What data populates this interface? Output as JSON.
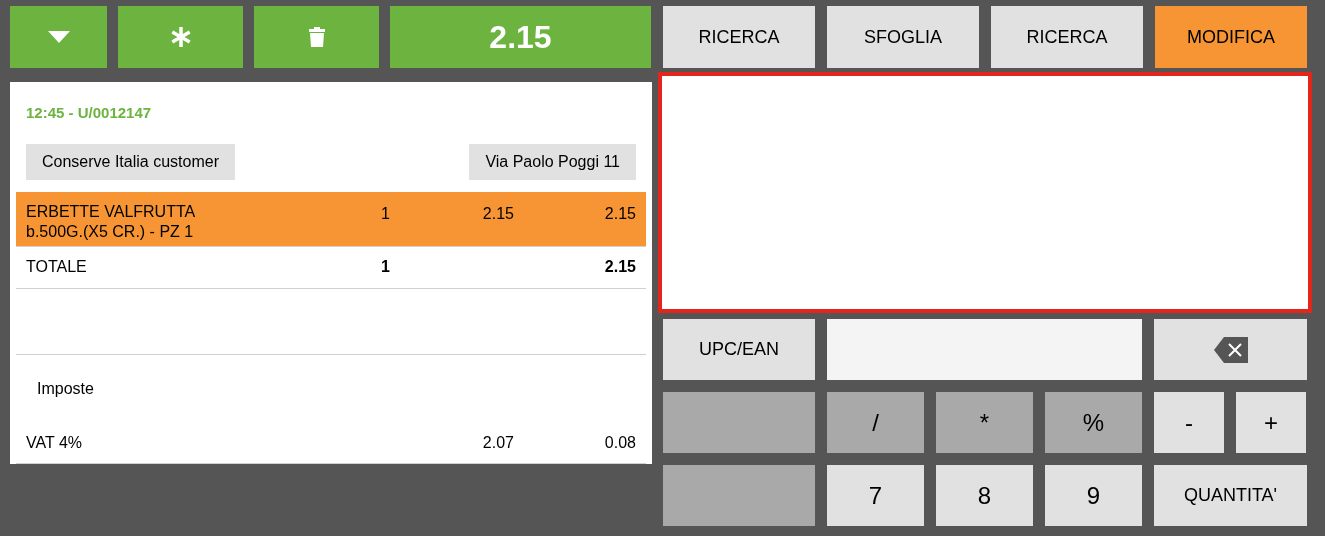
{
  "toolbar": {
    "buttons": [
      {
        "kind": "caret"
      },
      {
        "kind": "asterisk"
      },
      {
        "kind": "trash"
      }
    ],
    "total": "2.15"
  },
  "receipt": {
    "header": "12:45 - U/0012147",
    "customer": "Conserve Italia customer",
    "address": "Via Paolo Poggi 11",
    "items": [
      {
        "description": [
          "ERBETTE VALFRUTTA",
          "b.500G.(X5 CR.) - PZ 1"
        ],
        "quantity": "1",
        "price": "2.15",
        "amount": "2.15",
        "selected": true
      }
    ],
    "totals": {
      "label": "TOTALE",
      "quantity": "1",
      "amount": "2.15"
    },
    "taxes": {
      "title": "Imposte",
      "rows": [
        {
          "label": "VAT 4%",
          "base": "2.07",
          "tax": "0.08"
        }
      ]
    }
  },
  "tabs": [
    {
      "label": "RICERCA",
      "selected": false
    },
    {
      "label": "SFOGLIA",
      "selected": false
    },
    {
      "label": "RICERCA",
      "selected": false
    },
    {
      "label": "MODIFICA",
      "selected": true
    }
  ],
  "keypad": {
    "code_button": "UPC/EAN",
    "operators": [
      "/",
      "*",
      "%"
    ],
    "signs": [
      "-",
      "+"
    ],
    "digits": [
      "7",
      "8",
      "9"
    ],
    "quantity_button": "QUANTITA'"
  }
}
